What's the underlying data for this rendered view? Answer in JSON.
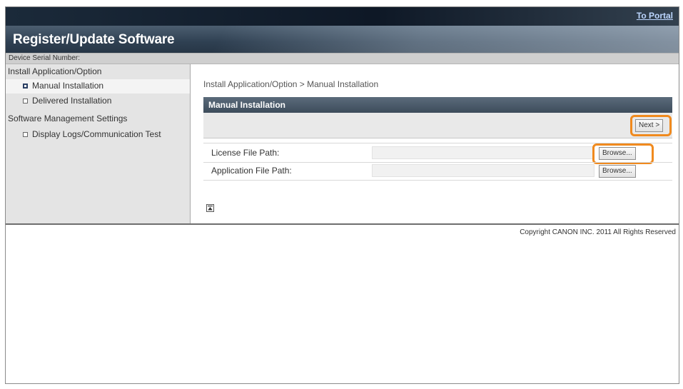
{
  "header": {
    "portal_link": "To Portal",
    "title": "Register/Update Software"
  },
  "serial": {
    "label": "Device Serial Number:"
  },
  "sidebar": {
    "groups": [
      {
        "heading": "Install Application/Option",
        "items": [
          {
            "label": "Manual Installation",
            "selected": true
          },
          {
            "label": "Delivered Installation",
            "selected": false
          }
        ]
      },
      {
        "heading": "Software Management Settings",
        "items": [
          {
            "label": "Display Logs/Communication Test",
            "selected": false
          }
        ]
      }
    ]
  },
  "main": {
    "breadcrumb": "Install Application/Option > Manual Installation",
    "panel_title": "Manual Installation",
    "next_button": "Next >",
    "fields": [
      {
        "label": "License File Path:",
        "value": "",
        "browse": "Browse..."
      },
      {
        "label": "Application File Path:",
        "value": "",
        "browse": "Browse..."
      }
    ]
  },
  "footer": {
    "copyright": "Copyright CANON INC. 2011 All Rights Reserved"
  },
  "colors": {
    "highlight": "#f08a1e",
    "header_dark": "#0e1826",
    "panel_head": "#3d4c5b"
  }
}
